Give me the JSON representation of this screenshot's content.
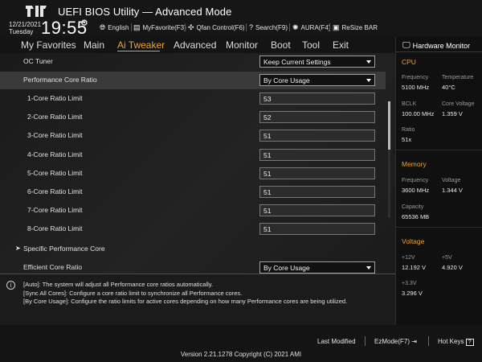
{
  "header": {
    "title": "UEFI BIOS Utility — Advanced Mode",
    "date": "12/21/2021",
    "day": "Tuesday",
    "time": "19:55",
    "toolbar": [
      {
        "icon": "globe-icon",
        "label": "English"
      },
      {
        "icon": "favorite-icon",
        "label": "MyFavorite(F3)"
      },
      {
        "icon": "fan-icon",
        "label": "Qfan Control(F6)"
      },
      {
        "icon": "search-icon",
        "label": "Search(F9)"
      },
      {
        "icon": "aura-icon",
        "label": "AURA(F4)"
      },
      {
        "icon": "resize-bar-icon",
        "label": "ReSize BAR"
      }
    ]
  },
  "menu": {
    "items": [
      "My Favorites",
      "Main",
      "Ai Tweaker",
      "Advanced",
      "Monitor",
      "Boot",
      "Tool",
      "Exit"
    ],
    "active": "Ai Tweaker"
  },
  "settings": [
    {
      "label": "OC Tuner",
      "value": "Keep Current Settings",
      "type": "select"
    },
    {
      "label": "Performance Core Ratio",
      "value": "By Core Usage",
      "type": "select"
    },
    {
      "label": "1-Core Ratio Limit",
      "value": "53",
      "type": "input"
    },
    {
      "label": "2-Core Ratio Limit",
      "value": "52",
      "type": "input"
    },
    {
      "label": "3-Core Ratio Limit",
      "value": "51",
      "type": "input"
    },
    {
      "label": "4-Core Ratio Limit",
      "value": "51",
      "type": "input"
    },
    {
      "label": "5-Core Ratio Limit",
      "value": "51",
      "type": "input"
    },
    {
      "label": "6-Core Ratio Limit",
      "value": "51",
      "type": "input"
    },
    {
      "label": "7-Core Ratio Limit",
      "value": "51",
      "type": "input"
    },
    {
      "label": "8-Core Ratio Limit",
      "value": "51",
      "type": "input"
    },
    {
      "label": "Specific Performance Core",
      "type": "submenu"
    },
    {
      "label": "Efficient Core Ratio",
      "value": "By Core Usage",
      "type": "select"
    }
  ],
  "help": {
    "lines": [
      "[Auto]: The system will adjust all Performance core ratios automatically.",
      "[Sync All Cores]: Configure a core ratio limit to synchronize all Performance cores.",
      "[By Core Usage]: Configure the ratio limits for active cores depending on how many Performance cores are being utilized."
    ]
  },
  "hardware_monitor": {
    "title": "Hardware Monitor",
    "cpu": {
      "section": "CPU",
      "frequency_label": "Frequency",
      "frequency": "5100 MHz",
      "temperature_label": "Temperature",
      "temperature": "40°C",
      "bclk_label": "BCLK",
      "bclk": "100.00 MHz",
      "core_voltage_label": "Core Voltage",
      "core_voltage": "1.359 V",
      "ratio_label": "Ratio",
      "ratio": "51x"
    },
    "memory": {
      "section": "Memory",
      "frequency_label": "Frequency",
      "frequency": "3600 MHz",
      "voltage_label": "Voltage",
      "voltage": "1.344 V",
      "capacity_label": "Capacity",
      "capacity": "65536 MB"
    },
    "voltage": {
      "section": "Voltage",
      "v12_label": "+12V",
      "v12": "12.192 V",
      "v5_label": "+5V",
      "v5": "4.920 V",
      "v33_label": "+3.3V",
      "v33": "3.296 V"
    }
  },
  "footer": {
    "last_modified": "Last Modified",
    "ezmode": "EzMode(F7)",
    "hotkeys": "Hot Keys",
    "copyright": "Version 2.21.1278 Copyright (C) 2021 AMI"
  },
  "colors": {
    "accent": "#e8a23a",
    "background": "#141414",
    "selected_row": "#3a3a3a"
  }
}
